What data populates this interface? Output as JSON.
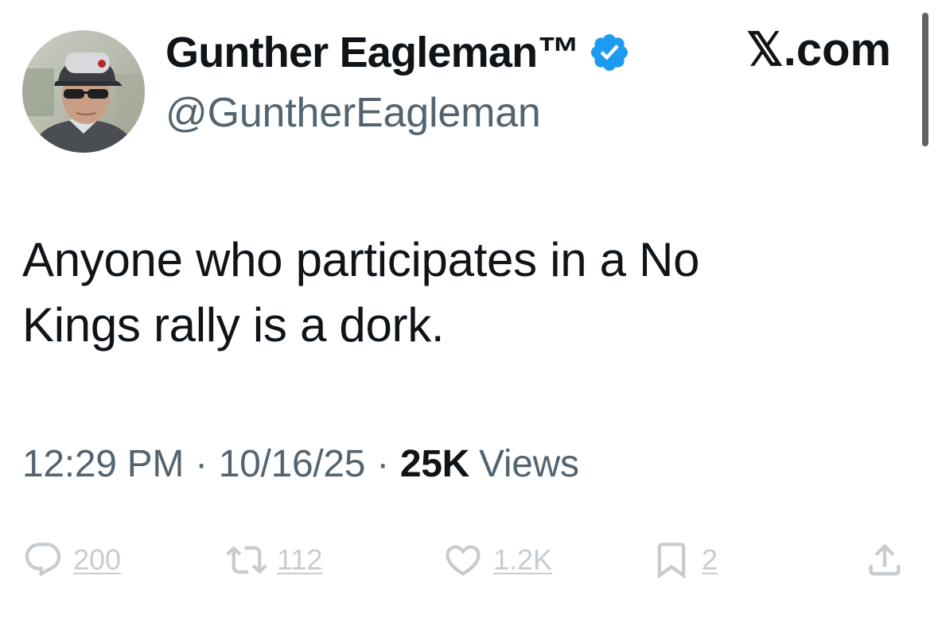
{
  "author": {
    "display_name": "Gunther Eagleman™",
    "handle": "@GuntherEagleman",
    "verified": true,
    "avatar_icon": "profile-photo"
  },
  "site": {
    "label": "𝕏.com"
  },
  "tweet": {
    "text": "Anyone who participates in a No\nKings rally is a dork.",
    "time": "12:29 PM",
    "separator": "·",
    "date": "10/16/25",
    "views_count": "25K",
    "views_label": "Views"
  },
  "actions": {
    "reply_count": "200",
    "repost_count": "112",
    "like_count": "1.2K",
    "bookmark_count": "2"
  },
  "colors": {
    "primary_text": "#0f1419",
    "secondary_text": "#536471",
    "verified_blue": "#1d9bf0",
    "background": "#ffffff"
  },
  "icons": {
    "verified": "verified-badge-icon",
    "reply": "reply-icon",
    "repost": "repost-icon",
    "like": "heart-icon",
    "bookmark": "bookmark-icon",
    "share": "share-icon"
  }
}
